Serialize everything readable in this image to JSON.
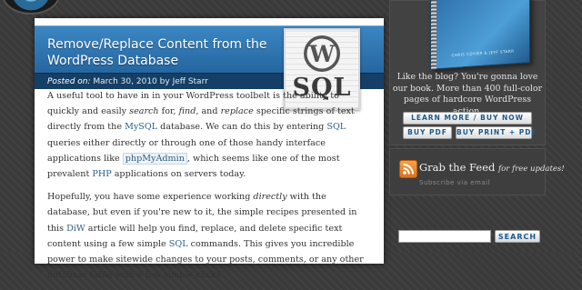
{
  "post": {
    "title": "Remove/Replace Content from the WordPress Database",
    "posted_on_label": "Posted on:",
    "date": "March 30, 2010",
    "by": "by",
    "author": "Jeff Starr",
    "thumbnail_text": "SQL",
    "p1": {
      "t1": "A useful tool to have in in your WordPress toolbelt is the ability to quickly and easily ",
      "search": "search",
      "t2": " for, ",
      "find": "find",
      "t3": ", and ",
      "replace": "replace",
      "t4": " specific strings of text directly from the ",
      "mysql": "MySQL",
      "t5": " database. We can do this by entering ",
      "sql": "SQL",
      "t6": " queries either directly or through one of those handy interface applications like ",
      "phpmyadmin": "phpMyAdmin",
      "t7": ", which seems like one of the most prevalent ",
      "php": "PHP",
      "t8": " applications on servers today."
    },
    "p2": {
      "t1": "Hopefully, you have some experience working ",
      "directly": "directly",
      "t2": " with the database, but even if you're new to it, the simple recipes presented in this ",
      "diw": "DiW",
      "t3": " article will help you find, replace, and delete specific text content using a few simple ",
      "sql": "SQL",
      "t4": " commands. This gives you incredible power to make sitewide changes to your posts, comments, or any other database table with a few simple clicks."
    }
  },
  "sidebar": {
    "book_authors": "CHRIS COYIER & JEFF STARR",
    "book_description": "Like the blog? You're gonna love our book. More than 400 full-color pages of hardcore WordPress action.",
    "learn_more_label": "LEARN MORE / BUY NOW",
    "buy_pdf_label": "BUY PDF",
    "buy_print_label": "BUY PRINT + PDF",
    "feed_title": "Grab the Feed",
    "feed_suffix": "for free updates!",
    "feed_email": "Subscribe via email",
    "search_button": "SEARCH",
    "search_value": ""
  },
  "colors": {
    "title_bar": "#2f78b6",
    "meta_bar": "#153f66",
    "link": "#2a5e8c",
    "rss": "#f08a2a"
  }
}
